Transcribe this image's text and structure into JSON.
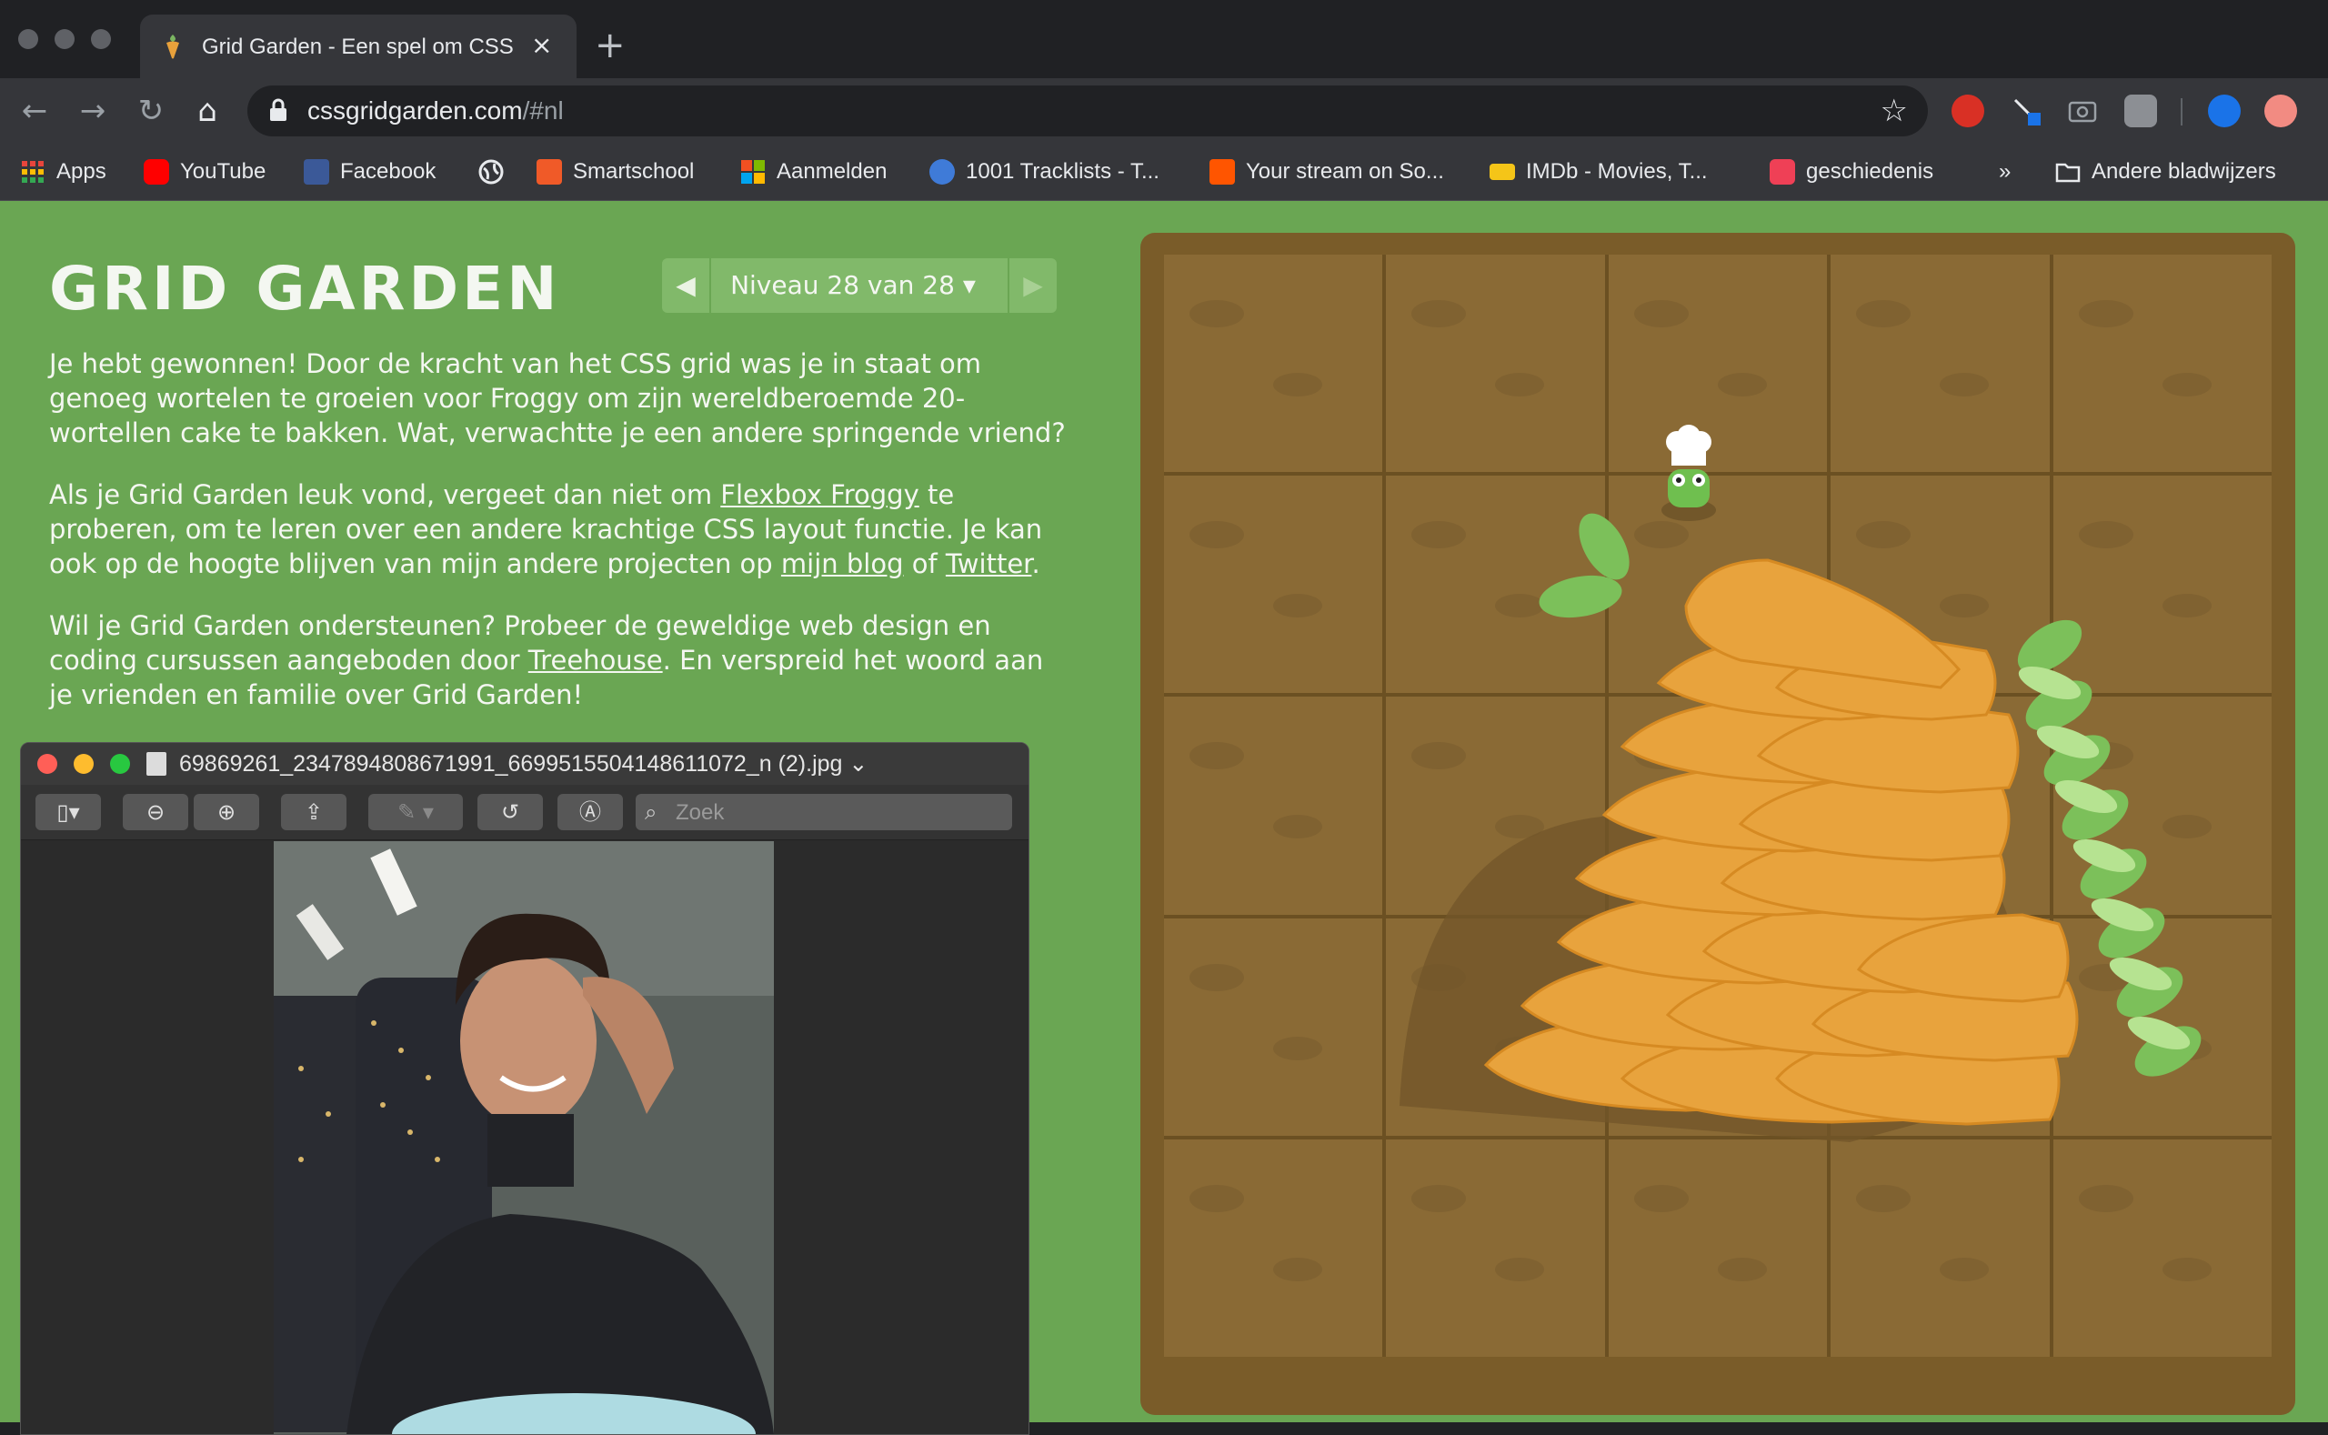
{
  "browser": {
    "tab": {
      "title": "Grid Garden - Een spel om CSS",
      "close": "×"
    },
    "new_tab": "+",
    "nav": {
      "back": "←",
      "forward": "→",
      "reload": "↻",
      "home": "⌂"
    },
    "url": {
      "host": "cssgridgarden.com",
      "path": "/#nl"
    },
    "star": "☆",
    "bookmarks": [
      {
        "label": "Apps",
        "icon": "apps-grid-icon",
        "color": "#e8453c"
      },
      {
        "label": "YouTube",
        "icon": "youtube-icon",
        "color": "#ff0000"
      },
      {
        "label": "Facebook",
        "icon": "facebook-icon",
        "color": "#3b5998"
      },
      {
        "label": "",
        "icon": "globe-icon",
        "color": "#e8eaed"
      },
      {
        "label": "Smartschool",
        "icon": "smartschool-icon",
        "color": "#f05a28"
      },
      {
        "label": "Aanmelden",
        "icon": "microsoft-icon",
        "color": "#f25022"
      },
      {
        "label": "1001 Tracklists - T...",
        "icon": "headphones-icon",
        "color": "#3f7bd8"
      },
      {
        "label": "Your stream on So...",
        "icon": "soundcloud-icon",
        "color": "#ff5500"
      },
      {
        "label": "IMDb - Movies, T...",
        "icon": "imdb-icon",
        "color": "#f5c518"
      },
      {
        "label": "geschiedenis",
        "icon": "pocket-icon",
        "color": "#ef4056"
      }
    ],
    "bookmarks_more": "»",
    "other_bookmarks": "Andere bladwijzers"
  },
  "game": {
    "logo": "GRID GARDEN",
    "level": {
      "label": "Niveau 28 van 28",
      "prev": "◀",
      "next": "▶",
      "caret": "▾"
    },
    "para1": "Je hebt gewonnen! Door de kracht van het CSS grid was je in staat om genoeg wortelen te groeien voor Froggy om zijn wereldberoemde 20-wortellen cake te bakken. Wat, verwachtte je een andere springende vriend?",
    "para2": {
      "t1": "Als je Grid Garden leuk vond, vergeet dan niet om ",
      "link1": "Flexbox Froggy",
      "t2": " te proberen, om te leren over een andere krachtige CSS layout functie. Je kan ook op de hoogte blijven van mijn andere projecten op ",
      "link2": "mijn blog",
      "t3": " of ",
      "link3": "Twitter",
      "t4": "."
    },
    "para3": {
      "t1": "Wil je Grid Garden ondersteunen? Probeer de geweldige web design en coding cursussen aangeboden door ",
      "link1": "Treehouse",
      "t2": ". En verspreid het woord aan je vrienden en familie over Grid Garden!"
    }
  },
  "preview": {
    "filename": "69869261_2347894808671991_6699515504148611072_n (2).jpg",
    "filename_caret": "⌄",
    "search_placeholder": "Zoek"
  }
}
